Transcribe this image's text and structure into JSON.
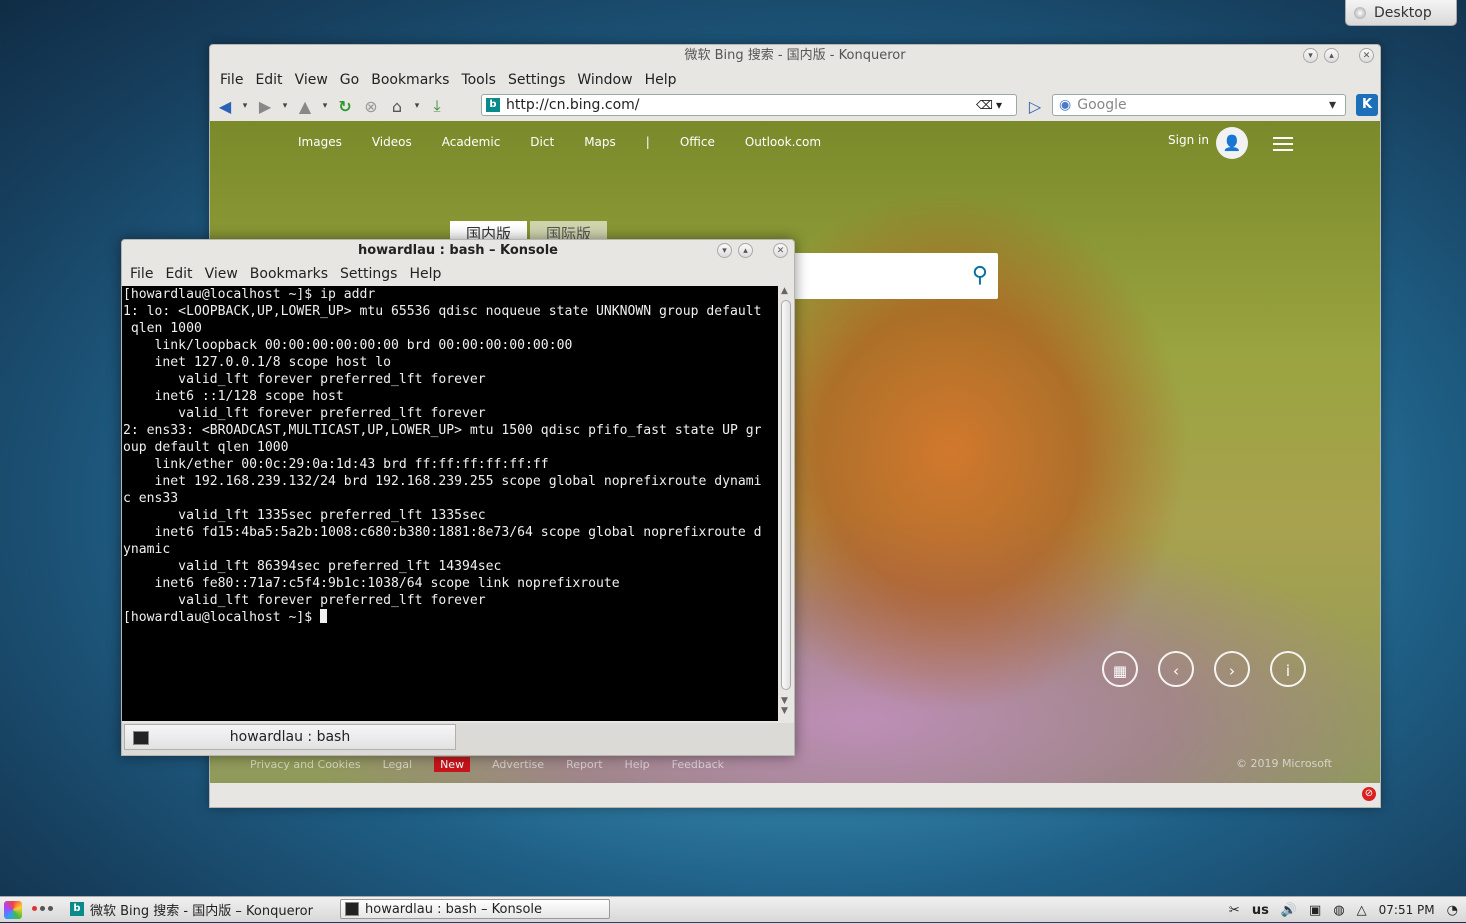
{
  "desktop": {
    "tab_label": "Desktop"
  },
  "konqueror": {
    "title": "微软 Bing 搜索 - 国内版 - Konqueror",
    "menu": [
      "File",
      "Edit",
      "View",
      "Go",
      "Bookmarks",
      "Tools",
      "Settings",
      "Window",
      "Help"
    ],
    "url": "http://cn.bing.com/",
    "search_placeholder": "Google",
    "page": {
      "nav": [
        "Images",
        "Videos",
        "Academic",
        "Dict",
        "Maps",
        "|",
        "Office",
        "Outlook.com"
      ],
      "sign_in": "Sign in",
      "region_tabs": [
        "国内版",
        "国际版"
      ],
      "footer": [
        "Privacy and Cookies",
        "Legal",
        "New",
        "Advertise",
        "Report",
        "Help",
        "Feedback"
      ],
      "copyright": "© 2019 Microsoft"
    }
  },
  "konsole": {
    "title": "howardlau : bash – Konsole",
    "menu": [
      "File",
      "Edit",
      "View",
      "Bookmarks",
      "Settings",
      "Help"
    ],
    "terminal_lines": [
      "[howardlau@localhost ~]$ ip addr",
      "1: lo: <LOOPBACK,UP,LOWER_UP> mtu 65536 qdisc noqueue state UNKNOWN group default",
      " qlen 1000",
      "    link/loopback 00:00:00:00:00:00 brd 00:00:00:00:00:00",
      "    inet 127.0.0.1/8 scope host lo",
      "       valid_lft forever preferred_lft forever",
      "    inet6 ::1/128 scope host",
      "       valid_lft forever preferred_lft forever",
      "2: ens33: <BROADCAST,MULTICAST,UP,LOWER_UP> mtu 1500 qdisc pfifo_fast state UP gr",
      "oup default qlen 1000",
      "    link/ether 00:0c:29:0a:1d:43 brd ff:ff:ff:ff:ff:ff",
      "    inet 192.168.239.132/24 brd 192.168.239.255 scope global noprefixroute dynami",
      "c ens33",
      "       valid_lft 1335sec preferred_lft 1335sec",
      "    inet6 fd15:4ba5:5a2b:1008:c680:b380:1881:8e73/64 scope global noprefixroute d",
      "ynamic",
      "       valid_lft 86394sec preferred_lft 14394sec",
      "    inet6 fe80::71a7:c5f4:9b1c:1038/64 scope link noprefixroute",
      "       valid_lft forever preferred_lft forever"
    ],
    "prompt": "[howardlau@localhost ~]$ ",
    "tab_label": "howardlau : bash"
  },
  "taskbar": {
    "tasks": [
      "微软 Bing 搜索 - 国内版 – Konqueror",
      "howardlau : bash – Konsole"
    ],
    "keyboard_layout": "us",
    "clock": "07:51 PM"
  }
}
